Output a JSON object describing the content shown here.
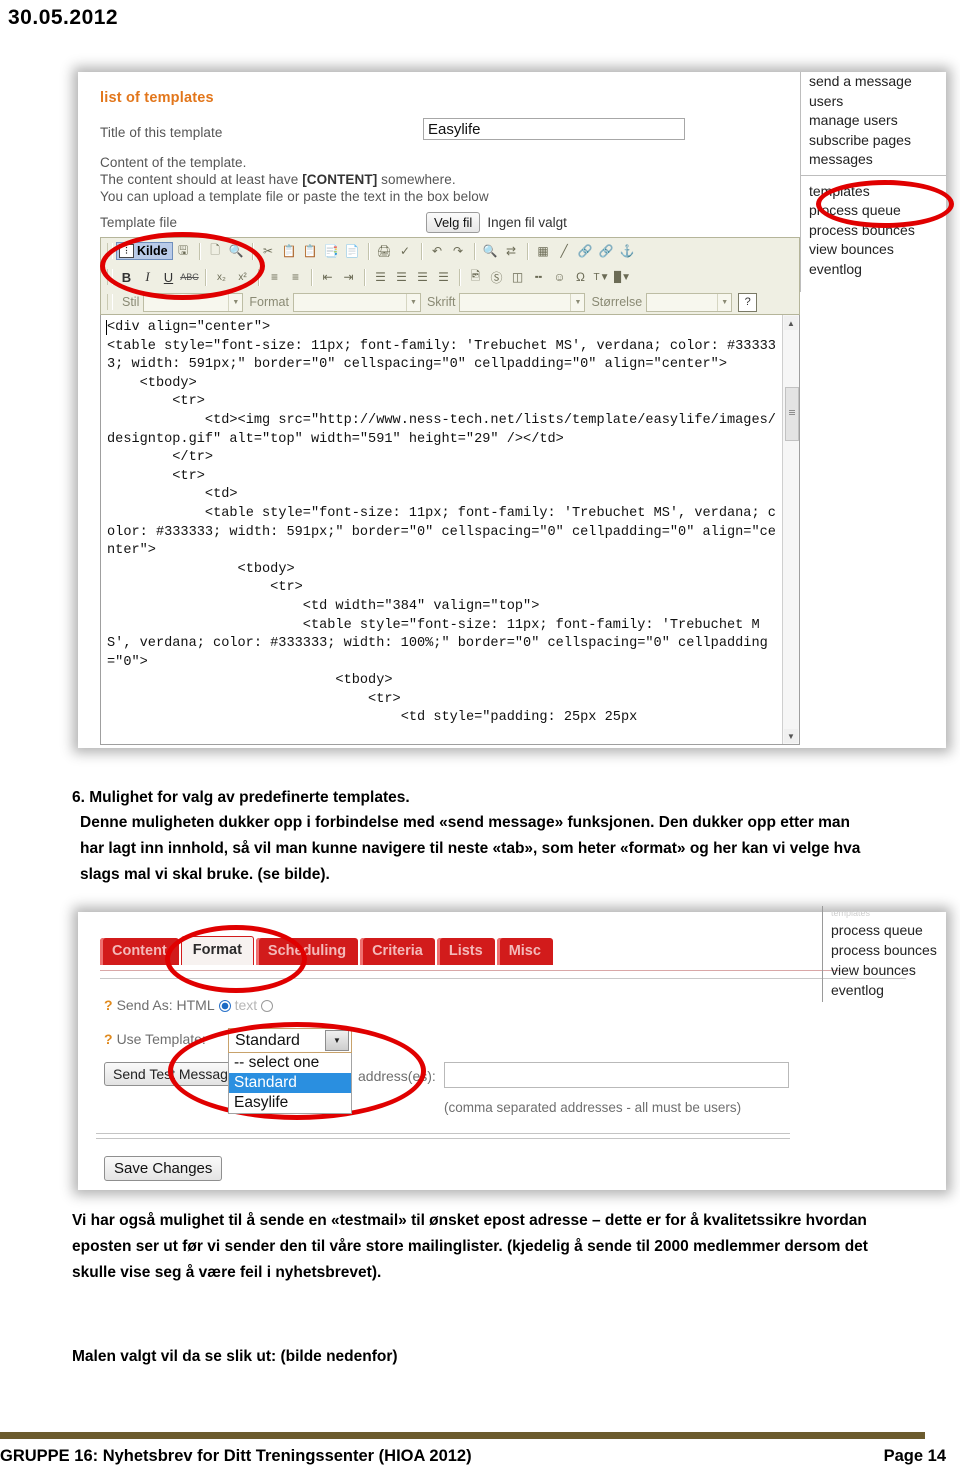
{
  "document": {
    "date": "30.05.2012",
    "footer_left": "GRUPPE 16: Nyhetsbrev for Ditt Treningssenter (HIOA 2012)",
    "footer_right": "Page 14"
  },
  "screenshot1": {
    "panel_title": "list of templates",
    "label_title": "Title of this template",
    "label_content": "Content of the template.",
    "label_content2_a": "The content should at least have ",
    "label_content2_b": "[CONTENT]",
    "label_content2_c": " somewhere.",
    "label_content3": "You can upload a template file or paste the text in the box below",
    "label_templatefile": "Template file",
    "title_value": "Easylife",
    "file_button": "Velg fil",
    "file_status": "Ingen fil valgt",
    "toolbar": {
      "source_button": "Kilde",
      "source_icon_glyph": "↯",
      "style_label": "Stil",
      "format_label": "Format",
      "font_label": "Skrift",
      "size_label": "Størrelse",
      "style_value": "",
      "format_value": "",
      "font_value": "",
      "size_value": "",
      "help_glyph": "?"
    },
    "source_code": "<div align=\"center\">\n<table style=\"font-size: 11px; font-family: 'Trebuchet MS', verdana; color: #333333; width: 591px;\" border=\"0\" cellspacing=\"0\" cellpadding=\"0\" align=\"center\">\n    <tbody>\n        <tr>\n            <td><img src=\"http://www.ness-tech.net/lists/template/easylife/images/designtop.gif\" alt=\"top\" width=\"591\" height=\"29\" /></td>\n        </tr>\n        <tr>\n            <td>\n            <table style=\"font-size: 11px; font-family: 'Trebuchet MS', verdana; color: #333333; width: 591px;\" border=\"0\" cellspacing=\"0\" cellpadding=\"0\" align=\"center\">\n                <tbody>\n                    <tr>\n                        <td width=\"384\" valign=\"top\">\n                        <table style=\"font-size: 11px; font-family: 'Trebuchet MS', verdana; color: #333333; width: 100%;\" border=\"0\" cellspacing=\"0\" cellpadding=\"0\">\n                            <tbody>\n                                <tr>\n                                    <td style=\"padding: 25px 25px",
    "nav": {
      "group1": [
        "send a message",
        "users",
        "manage users",
        "subscribe pages",
        "messages"
      ],
      "group2": [
        "templates",
        "process queue",
        "process bounces",
        "view bounces",
        "eventlog"
      ]
    }
  },
  "section": {
    "number": "6.",
    "heading": "Mulighet for valg av predefinerte templates.",
    "paragraph": "Denne muligheten dukker opp i forbindelse med «send message» funksjonen. Den dukker opp etter man har lagt inn innhold, så vil man kunne navigere til neste «tab», som heter «format» og her kan vi velge hva slags mal vi skal bruke. (se bilde)."
  },
  "screenshot2": {
    "tabs": [
      {
        "label": "Content",
        "active": false
      },
      {
        "label": "Format",
        "active": true
      },
      {
        "label": "Scheduling",
        "active": false
      },
      {
        "label": "Criteria",
        "active": false
      },
      {
        "label": "Lists",
        "active": false
      },
      {
        "label": "Misc",
        "active": false
      }
    ],
    "send_as_label": "Send As: HTML",
    "send_as_text_label": "text",
    "use_template_label": "Use Template:",
    "template_selected": "Standard",
    "template_options": [
      "-- select one",
      "Standard",
      "Easylife"
    ],
    "template_highlighted": "Standard",
    "test_button": "Send Test Message",
    "address_label": "address(es):",
    "address_value": "",
    "address_hint": "(comma separated addresses - all must be users)",
    "save_button": "Save Changes",
    "nav_faded": "templates",
    "nav": [
      "process queue",
      "process bounces",
      "view bounces",
      "eventlog"
    ]
  },
  "closing": {
    "paragraph1": "Vi har også mulighet til å sende en «testmail» til ønsket epost adresse – dette er for å kvalitetssikre hvordan eposten ser ut før vi sender den til våre store mailinglister. (kjedelig å sende til 2000 medlemmer dersom det skulle vise seg å være feil i nyhetsbrevet).",
    "paragraph2": "Malen valgt vil da se slik ut: (bilde nedenfor)"
  },
  "colors": {
    "panel_title": "#E2761B",
    "tab_red": "#d21b1b",
    "annotation_red": "#e00000",
    "footer_rule": "#6b5b2e",
    "select_highlight": "#2a8fe0"
  }
}
